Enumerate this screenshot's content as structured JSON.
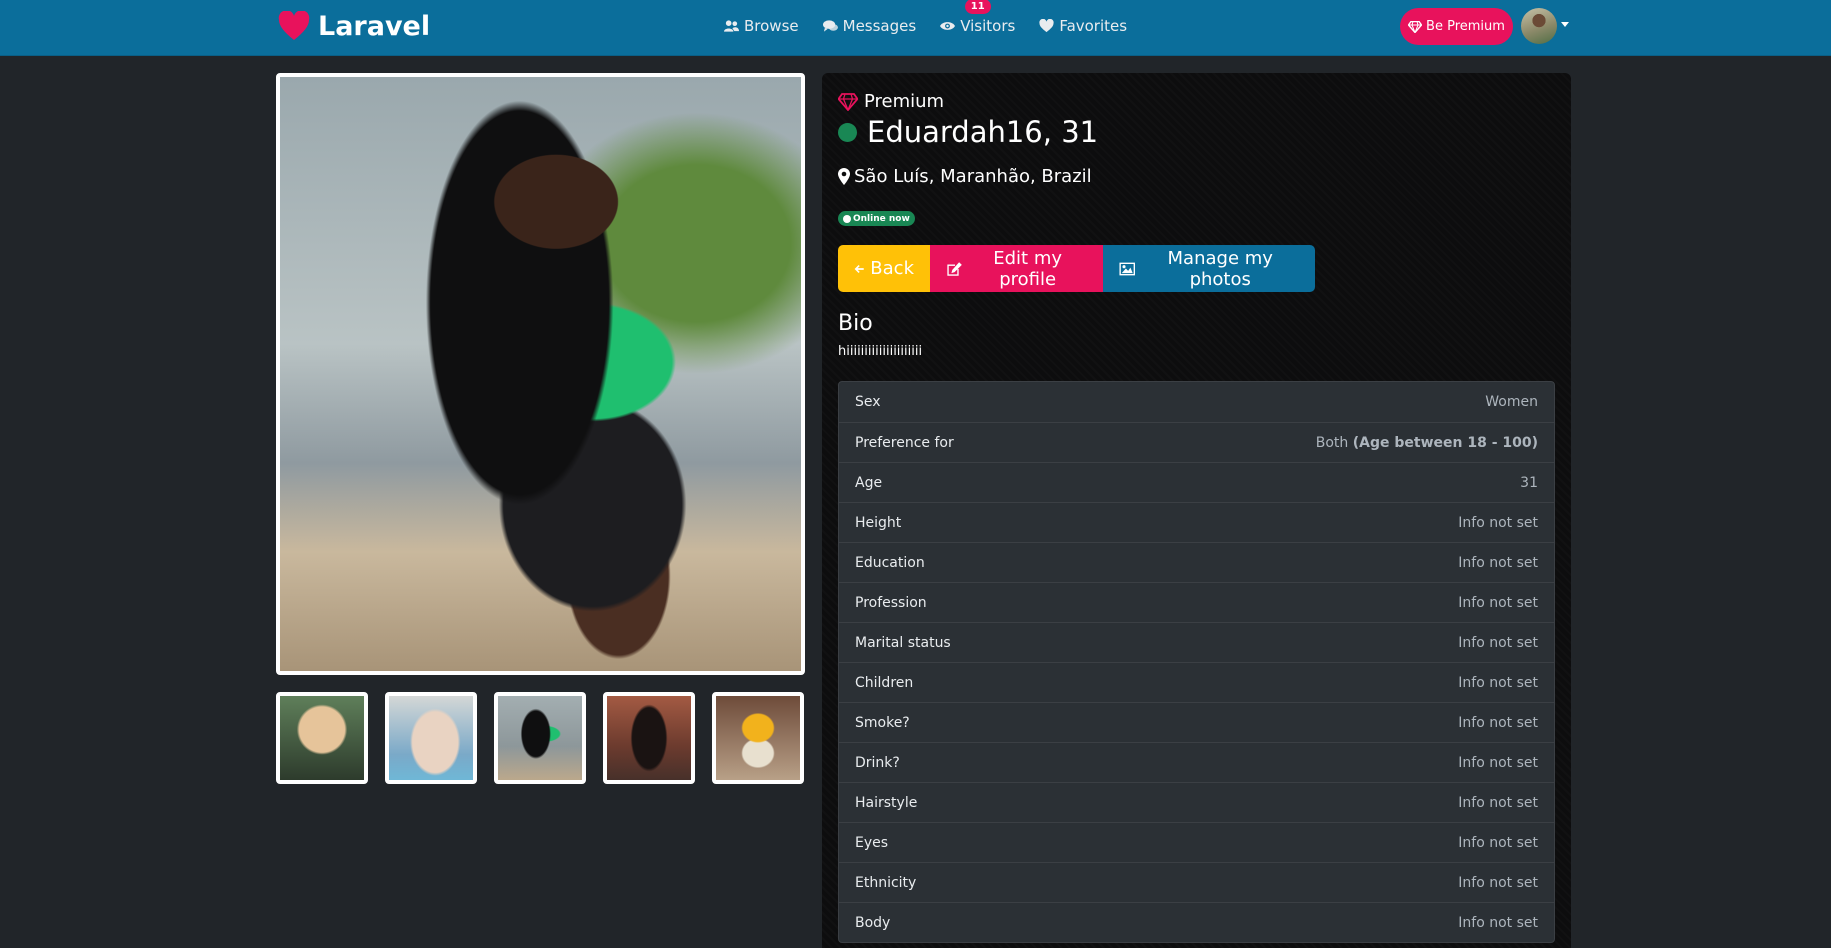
{
  "navbar": {
    "brand": "Laravel",
    "links": [
      {
        "label": "Browse",
        "icon": "users-icon"
      },
      {
        "label": "Messages",
        "icon": "comments-icon"
      },
      {
        "label": "Visitors",
        "icon": "eye-icon",
        "badge": "11"
      },
      {
        "label": "Favorites",
        "icon": "heart-icon"
      }
    ],
    "premium_button": "Be Premium"
  },
  "profile": {
    "premium_label": "Premium",
    "name_age": "Eduardah16, 31",
    "location": "São Luís, Maranhão, Brazil",
    "online_badge": "Online now",
    "buttons": {
      "back": "Back",
      "edit": "Edit my profile",
      "photos": "Manage my photos"
    },
    "bio_title": "Bio",
    "bio_text": "hiiiiiiiiiiiiiiiiiiiii",
    "details": [
      {
        "label": "Sex",
        "value": "Women"
      },
      {
        "label": "Preference for",
        "value": "Both ",
        "extra": "(Age between 18 - 100)"
      },
      {
        "label": "Age",
        "value": "31"
      },
      {
        "label": "Height",
        "value": "Info not set"
      },
      {
        "label": "Education",
        "value": "Info not set"
      },
      {
        "label": "Profession",
        "value": "Info not set"
      },
      {
        "label": "Marital status",
        "value": "Info not set"
      },
      {
        "label": "Children",
        "value": "Info not set"
      },
      {
        "label": "Smoke?",
        "value": "Info not set"
      },
      {
        "label": "Drink?",
        "value": "Info not set"
      },
      {
        "label": "Hairstyle",
        "value": "Info not set"
      },
      {
        "label": "Eyes",
        "value": "Info not set"
      },
      {
        "label": "Ethnicity",
        "value": "Info not set"
      },
      {
        "label": "Body",
        "value": "Info not set"
      }
    ]
  },
  "colors": {
    "navbar": "#0b6e9b",
    "accent_pink": "#e8125c",
    "warning": "#ffc107",
    "online": "#198754",
    "background": "#212529"
  }
}
